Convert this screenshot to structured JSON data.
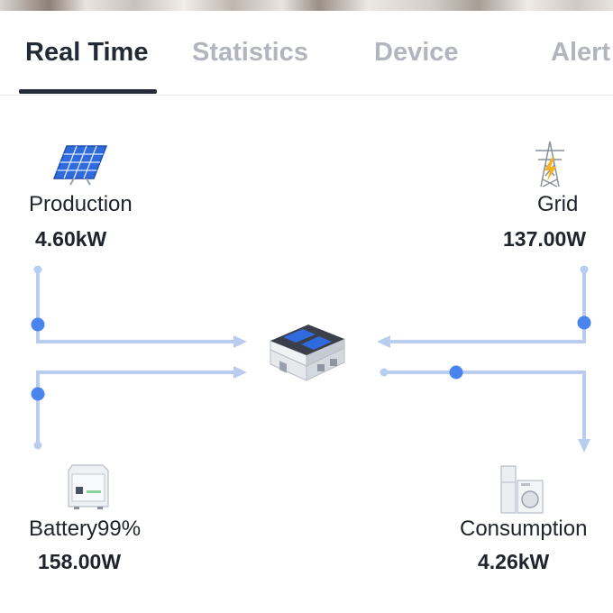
{
  "tabs": [
    {
      "label": "Real Time",
      "active": true
    },
    {
      "label": "Statistics",
      "active": false
    },
    {
      "label": "Device",
      "active": false
    },
    {
      "label": "Alert",
      "active": false
    }
  ],
  "nodes": {
    "production": {
      "label": "Production",
      "value": "4.60kW",
      "icon": "solar-panel-icon"
    },
    "grid": {
      "label": "Grid",
      "value": "137.00W",
      "icon": "power-tower-icon"
    },
    "battery": {
      "label": "Battery99%",
      "value": "158.00W",
      "icon": "battery-cabinet-icon"
    },
    "consumption": {
      "label": "Consumption",
      "value": "4.26kW",
      "icon": "appliances-icon"
    },
    "home": {
      "icon": "house-icon"
    }
  },
  "colors": {
    "flow_line": "#b9cdf1",
    "flow_dot": "#4a84ef",
    "tab_active": "#222a35",
    "tab_inactive": "#b2b5bd"
  }
}
